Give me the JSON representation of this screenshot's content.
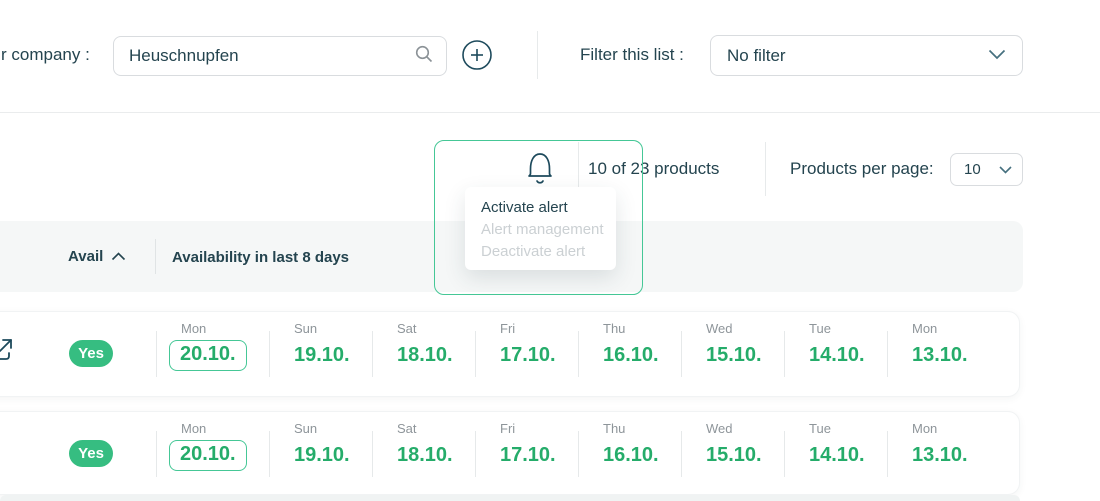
{
  "topbar": {
    "company_label": "r company :",
    "search": {
      "value": "Heuschnupfen"
    },
    "filter_label": "Filter this list :",
    "filter_value": "No filter"
  },
  "toolbar": {
    "products_summary": "10 of 23 products",
    "per_page_label": "Products per page:",
    "per_page_value": "10"
  },
  "alert_menu": {
    "items": [
      {
        "label": "Activate alert",
        "disabled": false
      },
      {
        "label": "Alert management",
        "disabled": true
      },
      {
        "label": "Deactivate alert",
        "disabled": true
      }
    ]
  },
  "table": {
    "header": {
      "avail_label": "Avail",
      "availability_label": "Availability in last 8 days"
    },
    "columns": [
      {
        "day": "Mon",
        "date": "20.10.",
        "highlighted": true
      },
      {
        "day": "Sun",
        "date": "19.10."
      },
      {
        "day": "Sat",
        "date": "18.10."
      },
      {
        "day": "Fri",
        "date": "17.10."
      },
      {
        "day": "Thu",
        "date": "16.10."
      },
      {
        "day": "Wed",
        "date": "15.10."
      },
      {
        "day": "Tue",
        "date": "14.10."
      },
      {
        "day": "Mon",
        "date": "13.10."
      }
    ],
    "rows": [
      {
        "avail": "Yes",
        "has_external_link": true
      },
      {
        "avail": "Yes",
        "has_external_link": false
      }
    ]
  },
  "icons": {
    "search": "search-icon",
    "add": "plus-circle-icon",
    "filter_chevron": "chevron-down-icon",
    "alerts": "bell-icon",
    "sort": "chevron-up-icon",
    "row_link": "external-link-icon"
  },
  "colors": {
    "accent_green": "#36BD81",
    "green_text": "#25AC6A",
    "green_border": "#45C796",
    "dark_navy": "#24444F",
    "gray_text": "#8E959A",
    "disabled_text": "#CBD0D3"
  }
}
